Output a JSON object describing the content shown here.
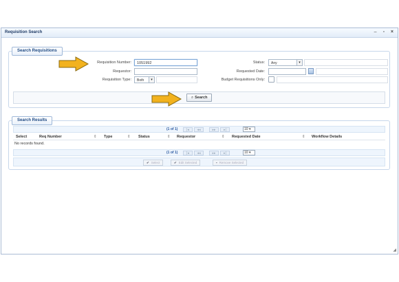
{
  "window": {
    "title": "Requisition Search",
    "controls": [
      "–",
      "▫",
      "×"
    ]
  },
  "search_panel": {
    "tab_label": "Search Requisitions",
    "requisition_number": {
      "label": "Requisition Number:",
      "value": "1051992"
    },
    "requestor": {
      "label": "Requestor:",
      "value": ""
    },
    "requisition_type": {
      "label": "Requisition Type:",
      "value": "Both"
    },
    "status": {
      "label": "Status:",
      "value": "Any"
    },
    "requested_date": {
      "label": "Requested Date:",
      "value": ""
    },
    "budget_only": {
      "label": "Budget Requisitions Only:",
      "checked": false
    },
    "search_button": "Search"
  },
  "results_panel": {
    "tab_label": "Search Results",
    "page_count": "(1 of 1)",
    "page_size": "10",
    "columns": [
      "Select",
      "Req Number",
      "Type",
      "Status",
      "Requestor",
      "Requested Date",
      "Workflow Details"
    ],
    "empty_message": "No records found.",
    "actions": [
      "Select",
      "Edit Selected",
      "Remove Selected"
    ]
  },
  "colors": {
    "accent": "#1f4a84",
    "arrow": "#f2b21e",
    "arrow_outline": "#8a6a10"
  }
}
